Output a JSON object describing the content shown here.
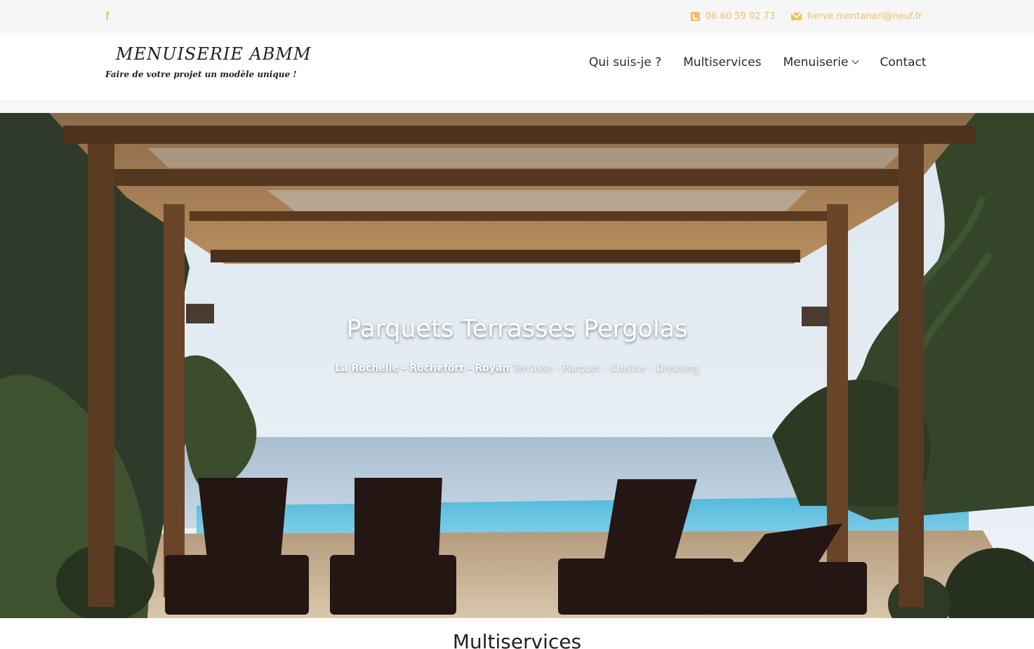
{
  "topbar": {
    "facebook_icon": "facebook-icon",
    "facebook_glyph": "f",
    "phone_icon": "phone-square-icon",
    "phone": "06 60 59 02 73",
    "email_icon": "envelope-icon",
    "email": "herve.montanari@neuf.fr",
    "accent_color": "#f2c062"
  },
  "header": {
    "logo_title": "MENUISERIE ABMM",
    "logo_tagline": "Faire de votre projet un modèle unique !",
    "nav": [
      {
        "label": "Qui suis-je ?"
      },
      {
        "label": "Multiservices"
      },
      {
        "label": "Menuiserie",
        "icon": "chevron-down-icon"
      },
      {
        "label": "Contact"
      }
    ]
  },
  "hero": {
    "title": "Parquets Terrasses Pergolas",
    "subtitle_locations": "La Rochelle - Rochefort - Royan",
    "subtitle_services": "Terrasse - Parquet - Cuisine - Dressing"
  },
  "section": {
    "title": "Multiservices"
  }
}
